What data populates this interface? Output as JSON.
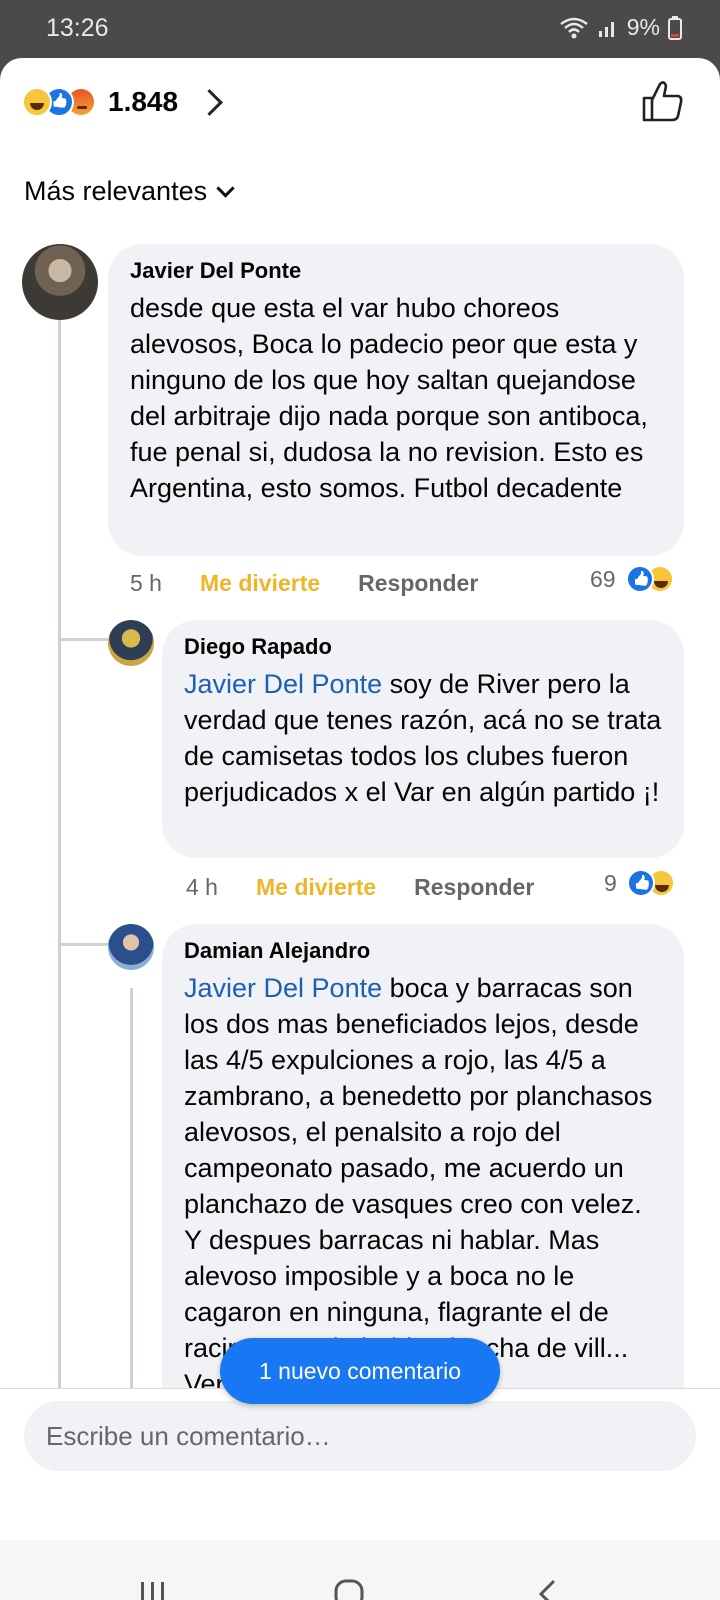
{
  "status": {
    "time": "13:26",
    "battery": "9%"
  },
  "header": {
    "reaction_count": "1.848",
    "icons": [
      "haha-icon",
      "like-icon",
      "angry-icon"
    ]
  },
  "sort": {
    "label": "Más relevantes"
  },
  "comments": [
    {
      "author": "Javier Del Ponte",
      "text": "desde que esta el var hubo choreos alevosos, Boca lo padecio peor que esta y ninguno de los que hoy saltan quejandose del arbitraje dijo nada porque son antiboca, fue penal si, dudosa la no revision. Esto es Argentina, esto somos. Futbol decadente",
      "time": "5 h",
      "my_reaction": "Me divierte",
      "reply": "Responder",
      "reactions": "69"
    },
    {
      "author": "Diego Rapado",
      "mention": "Javier Del Ponte",
      "text": " soy de River pero la verdad que tenes razón, acá no se trata de camisetas todos los clubes fueron perjudicados x el Var en algún partido ¡!",
      "time": "4 h",
      "my_reaction": "Me divierte",
      "reply": "Responder",
      "reactions": "9"
    },
    {
      "author": "Damian Alejandro",
      "mention": "Javier Del Ponte",
      "text": " boca y barracas son los dos mas beneficiados lejos, desde las 4/5 expulciones a rojo, las 4/5 a zambrano, a benedetto por planchasos alevosos, el penalsito a rojo del campeonato pasado, me acuerdo un planchazo de vasques creo con velez. Y despues barracas ni hablar. Mas alevoso imposible y a boca no le cagaron en ninguna, flagrante el de racing cuando habia plancha de vill... Ver"
    }
  ],
  "new_comments_pill": "1 nuevo comentario",
  "composer": {
    "placeholder": "Escribe un comentario…"
  },
  "colors": {
    "accent": "#1877f2",
    "reacted": "#f0b429",
    "bubble": "#f0f2f5"
  }
}
